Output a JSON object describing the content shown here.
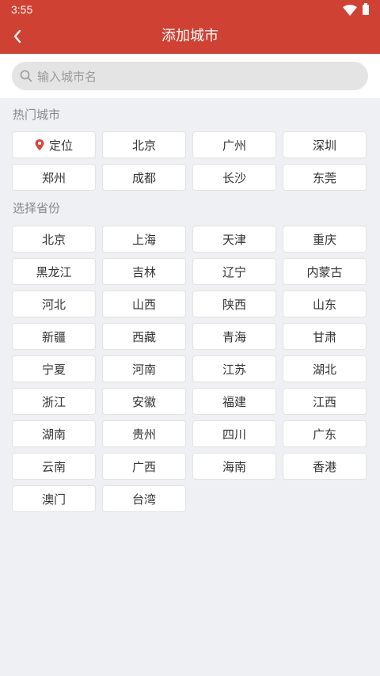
{
  "status": {
    "time": "3:55"
  },
  "header": {
    "title": "添加城市"
  },
  "search": {
    "placeholder": "输入城市名"
  },
  "hot": {
    "title": "热门城市",
    "locate_label": "定位",
    "cities": [
      "北京",
      "广州",
      "深圳",
      "郑州",
      "成都",
      "长沙",
      "东莞"
    ]
  },
  "provinces": {
    "title": "选择省份",
    "items": [
      "北京",
      "上海",
      "天津",
      "重庆",
      "黑龙江",
      "吉林",
      "辽宁",
      "内蒙古",
      "河北",
      "山西",
      "陕西",
      "山东",
      "新疆",
      "西藏",
      "青海",
      "甘肃",
      "宁夏",
      "河南",
      "江苏",
      "湖北",
      "浙江",
      "安徽",
      "福建",
      "江西",
      "湖南",
      "贵州",
      "四川",
      "广东",
      "云南",
      "广西",
      "海南",
      "香港",
      "澳门",
      "台湾"
    ]
  },
  "colors": {
    "brand": "#cf4132",
    "pin": "#d9483a"
  }
}
